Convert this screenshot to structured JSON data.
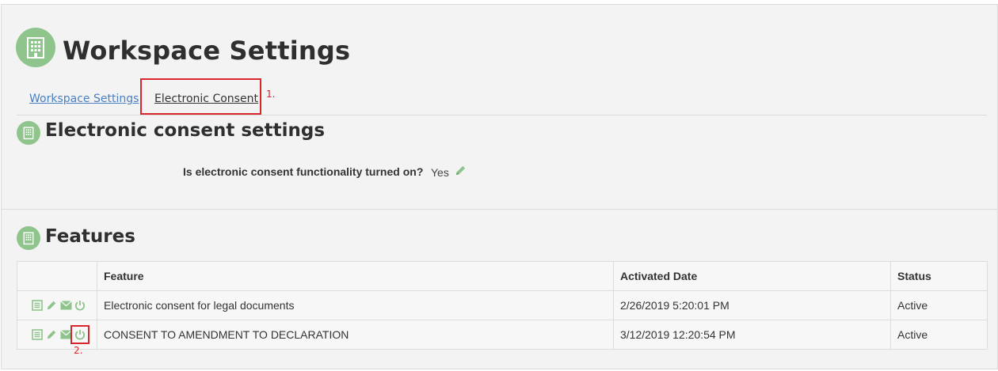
{
  "header": {
    "title": "Workspace Settings"
  },
  "tabs": [
    {
      "label": "Workspace Settings"
    },
    {
      "label": "Electronic Consent"
    }
  ],
  "annotations": {
    "label_1": "1.",
    "label_2": "2."
  },
  "consent_section": {
    "title": "Electronic consent settings",
    "question": "Is electronic consent functionality turned on?",
    "answer": "Yes"
  },
  "features_section": {
    "title": "Features",
    "columns": [
      "Feature",
      "Activated Date",
      "Status"
    ],
    "rows": [
      {
        "feature": "Electronic consent for legal documents",
        "activated_date": "2/26/2019 5:20:01 PM",
        "status": "Active"
      },
      {
        "feature": "CONSENT TO AMENDMENT TO DECLARATION",
        "activated_date": "3/12/2019 12:20:54 PM",
        "status": "Active"
      }
    ]
  },
  "colors": {
    "accent_green": "#8fc48c",
    "annotation_red": "#d9262d",
    "link_blue": "#4a7fc1"
  },
  "icons": [
    "building-icon",
    "pencil-icon",
    "list-icon",
    "envelope-icon",
    "power-icon"
  ]
}
